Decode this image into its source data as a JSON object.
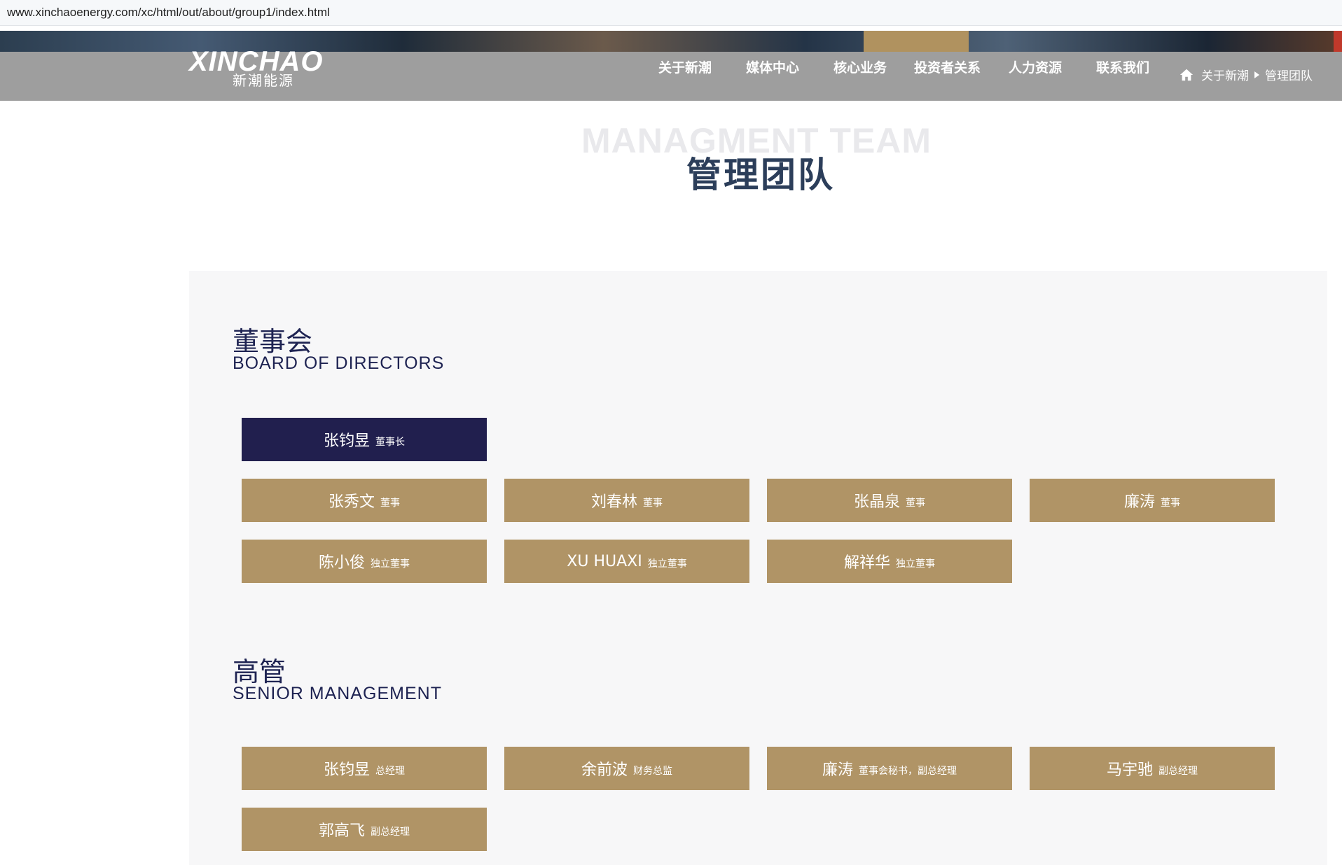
{
  "browser": {
    "url": "www.xinchaoenergy.com/xc/html/out/about/group1/index.html"
  },
  "brand": {
    "logo_en": "XINCHAO",
    "logo_cn": "新潮能源"
  },
  "nav": {
    "items": [
      "关于新潮",
      "媒体中心",
      "核心业务",
      "投资者关系",
      "人力资源",
      "联系我们"
    ]
  },
  "breadcrumb": {
    "items": [
      "关于新潮",
      "管理团队"
    ]
  },
  "page": {
    "title_en": "MANAGMENT TEAM",
    "title_cn": "管理团队"
  },
  "board": {
    "title_cn": "董事会",
    "title_en": "BOARD OF DIRECTORS",
    "chairman": {
      "name": "张钧昱",
      "role": "董事长"
    },
    "members": [
      {
        "name": "张秀文",
        "role": "董事"
      },
      {
        "name": "刘春林",
        "role": "董事"
      },
      {
        "name": "张晶泉",
        "role": "董事"
      },
      {
        "name": "廉涛",
        "role": "董事"
      },
      {
        "name": "陈小俊",
        "role": "独立董事"
      },
      {
        "name": "XU HUAXI",
        "role": "独立董事"
      },
      {
        "name": "解祥华",
        "role": "独立董事"
      }
    ]
  },
  "management": {
    "title_cn": "高管",
    "title_en": "SENIOR MANAGEMENT",
    "members": [
      {
        "name": "张钧昱",
        "role": "总经理"
      },
      {
        "name": "余前波",
        "role": "财务总监"
      },
      {
        "name": "廉涛",
        "role": "董事会秘书，副总经理"
      },
      {
        "name": "马宇驰",
        "role": "副总经理"
      },
      {
        "name": "郭高飞",
        "role": "副总经理"
      }
    ]
  },
  "colors": {
    "accent_gold": "#b09466",
    "chairman_navy": "#211f4e",
    "header_gray": "#9e9e9e",
    "heading_navy": "#1e2352"
  }
}
